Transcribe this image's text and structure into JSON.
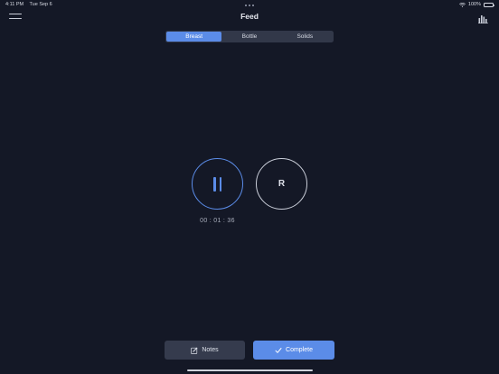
{
  "status_bar": {
    "time": "4:11 PM",
    "date": "Tue Sep 6",
    "battery": "100%"
  },
  "header": {
    "title": "Feed",
    "left_icon": "menu-icon",
    "right_icon": "bar-chart-icon"
  },
  "tabs": [
    {
      "label": "Breast",
      "active": true
    },
    {
      "label": "Bottle",
      "active": false
    },
    {
      "label": "Solids",
      "active": false
    }
  ],
  "timer": {
    "left_button_icon": "pause-icon",
    "right_button_label": "R",
    "elapsed": "00 : 01 : 36"
  },
  "actions": {
    "notes_label": "Notes",
    "complete_label": "Complete"
  },
  "colors": {
    "background": "#141826",
    "accent": "#5b8ce8",
    "secondary_button": "#353b4d"
  }
}
